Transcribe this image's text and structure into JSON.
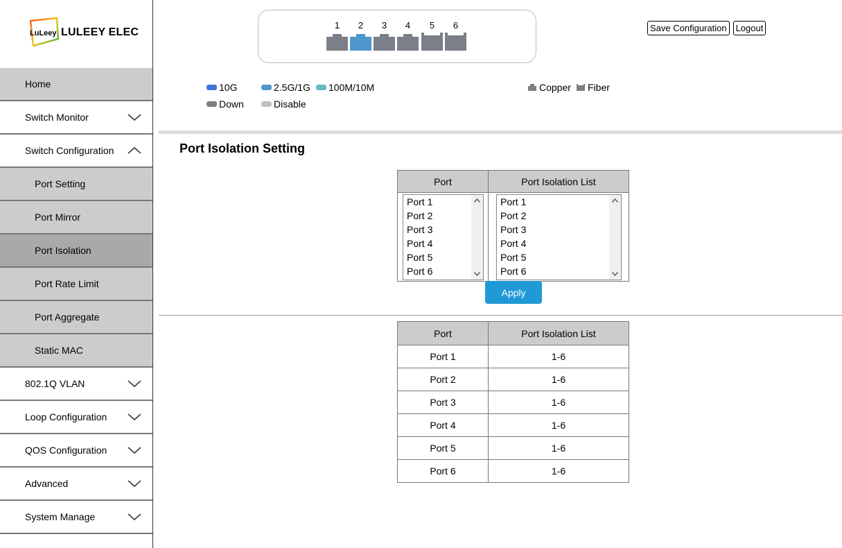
{
  "brand": {
    "badge_text": "LuLeey",
    "name": "LULEEY ELEC"
  },
  "sidebar": {
    "items": [
      {
        "label": "Home"
      },
      {
        "label": "Switch Monitor"
      },
      {
        "label": "Switch Configuration"
      },
      {
        "label": "Port Setting"
      },
      {
        "label": "Port Mirror"
      },
      {
        "label": "Port Isolation"
      },
      {
        "label": "Port Rate Limit"
      },
      {
        "label": "Port Aggregate"
      },
      {
        "label": "Static MAC"
      },
      {
        "label": "802.1Q VLAN"
      },
      {
        "label": "Loop Configuration"
      },
      {
        "label": "QOS Configuration"
      },
      {
        "label": "Advanced"
      },
      {
        "label": "System Manage"
      }
    ]
  },
  "ports": {
    "numbers": [
      "1",
      "2",
      "3",
      "4",
      "5",
      "6"
    ],
    "states": [
      "down-copper",
      "2.5g-copper",
      "down-copper",
      "down-copper",
      "down-fiber",
      "down-fiber"
    ]
  },
  "legend": {
    "speed_10g": "10G",
    "speed_2_5g_1g": "2.5G/1G",
    "speed_100m_10m": "100M/10M",
    "down": "Down",
    "disable": "Disable",
    "copper": "Copper",
    "fiber": "Fiber"
  },
  "colors": {
    "10g": "#3b73d9",
    "2_5g": "#4f96cc",
    "100m": "#6ab6c2",
    "down": "#7a7f88",
    "disable": "#bfbfbf",
    "accent": "#1f9ad6"
  },
  "toolbar": {
    "save_label": "Save Configuration",
    "logout_label": "Logout"
  },
  "page": {
    "title": "Port Isolation Setting"
  },
  "config_table": {
    "header_port": "Port",
    "header_list": "Port Isolation List",
    "port_options": [
      "Port 1",
      "Port 2",
      "Port 3",
      "Port 4",
      "Port 5",
      "Port 6"
    ],
    "list_options": [
      "Port 1",
      "Port 2",
      "Port 3",
      "Port 4",
      "Port 5",
      "Port 6"
    ],
    "apply_label": "Apply"
  },
  "result_table": {
    "header_port": "Port",
    "header_list": "Port Isolation List",
    "rows": [
      {
        "port": "Port 1",
        "list": "1-6"
      },
      {
        "port": "Port 2",
        "list": "1-6"
      },
      {
        "port": "Port 3",
        "list": "1-6"
      },
      {
        "port": "Port 4",
        "list": "1-6"
      },
      {
        "port": "Port 5",
        "list": "1-6"
      },
      {
        "port": "Port 6",
        "list": "1-6"
      }
    ]
  }
}
